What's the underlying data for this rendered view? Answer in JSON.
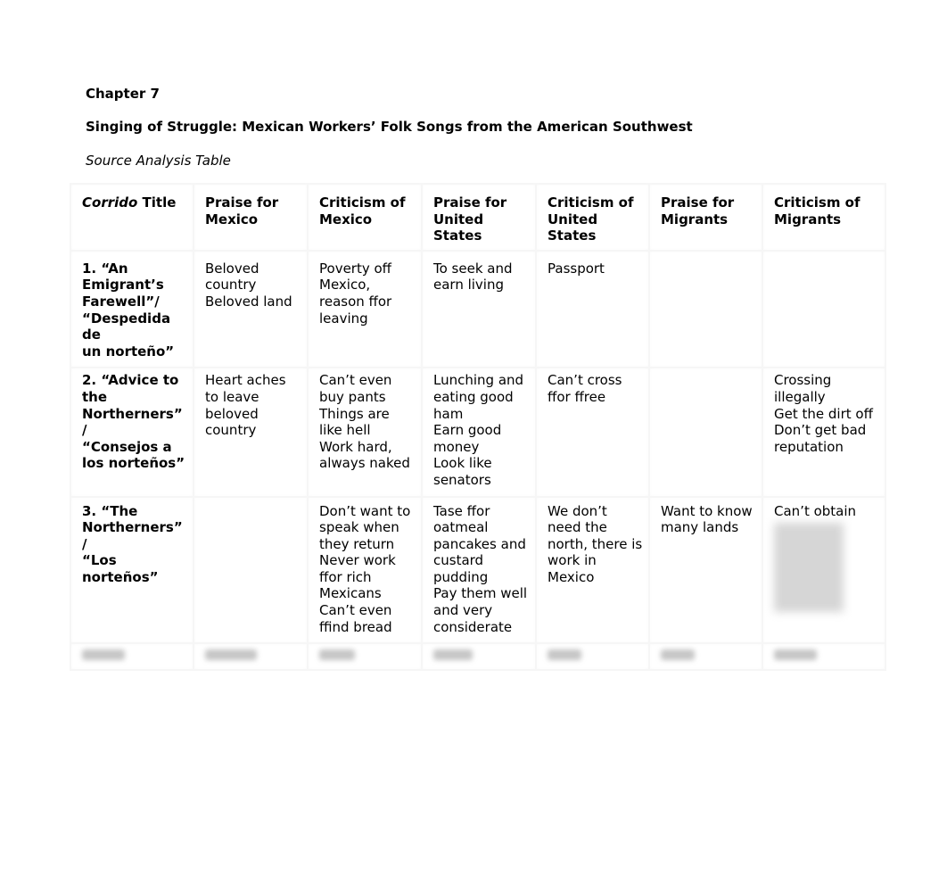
{
  "document": {
    "chapter": "Chapter 7",
    "title": "Singing of Struggle: Mexican Workers’ Folk Songs from the American Southwest",
    "subtitle": "Source Analysis Table"
  },
  "table": {
    "headers": {
      "corrido_italic": "Corrido",
      "corrido_rest": " Title",
      "praise_mexico": "Praise for Mexico",
      "criticism_mexico": "Criticism of Mexico",
      "praise_us": "Praise for United States",
      "criticism_us": "Criticism of United States",
      "praise_migrants": "Praise for Migrants",
      "criticism_migrants": "Criticism of Migrants"
    },
    "rows": [
      {
        "title": [
          "1. “An Emigrant’s Farewell”/",
          "“Despedida de",
          "un norteño”"
        ],
        "praise_mexico": [
          "Beloved country",
          "Beloved land"
        ],
        "criticism_mexico": [
          "Poverty off Mexico, reason ffor leaving"
        ],
        "praise_us": [
          "To seek and earn living"
        ],
        "criticism_us": [
          "Passport"
        ],
        "praise_migrants": [],
        "criticism_migrants": []
      },
      {
        "title": [
          "2. “Advice to the Northerners” /",
          "“Consejos a los norteños”"
        ],
        "praise_mexico": [
          "Heart aches to leave beloved country"
        ],
        "criticism_mexico": [
          "Can’t even buy pants",
          "Things are like hell",
          "Work hard, always naked"
        ],
        "praise_us": [
          "Lunching and eating good ham",
          "Earn good money",
          "Look like senators"
        ],
        "criticism_us": [
          "Can’t cross ffor ffree"
        ],
        "praise_migrants": [],
        "criticism_migrants": [
          "Crossing illegally",
          "Get the dirt off",
          "Don’t get bad reputation"
        ]
      },
      {
        "title": [
          "3. “The Northerners” /",
          "“Los norteños”"
        ],
        "praise_mexico": [],
        "criticism_mexico": [
          "Don’t want to speak when they return",
          "Never work ffor rich Mexicans",
          "Can’t even ffind bread"
        ],
        "praise_us": [
          "Tase ffor oatmeal pancakes and custard pudding",
          "Pay them well and very considerate"
        ],
        "criticism_us": [
          "We don’t need the north, there is work in Mexico"
        ],
        "praise_migrants": [
          "Want to know many lands"
        ],
        "criticism_migrants": [
          "Can’t obtain"
        ]
      }
    ]
  }
}
